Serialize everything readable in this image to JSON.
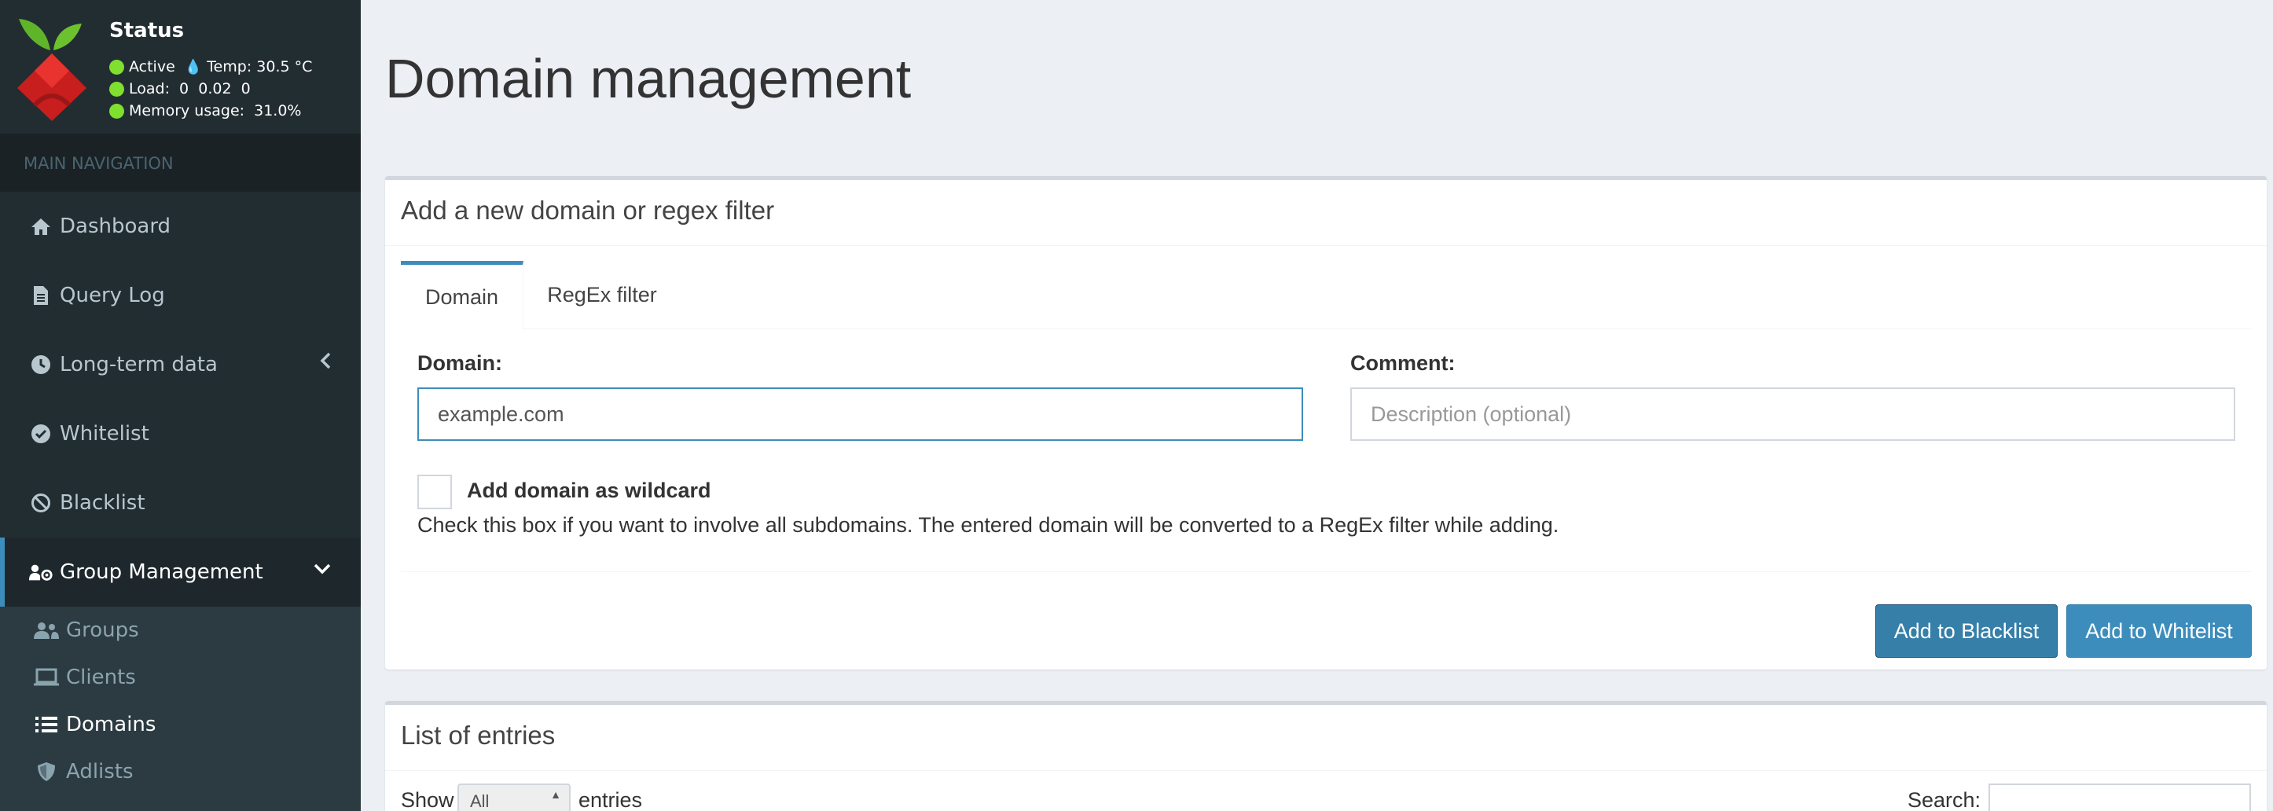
{
  "status": {
    "title": "Status",
    "active": "Active",
    "temp": "Temp: 30.5 °C",
    "load": "Load:  0  0.02  0",
    "memory": "Memory usage:  31.0%"
  },
  "nav": {
    "header": "MAIN NAVIGATION",
    "items": [
      {
        "label": "Dashboard",
        "icon": "home-icon"
      },
      {
        "label": "Query Log",
        "icon": "file-icon"
      },
      {
        "label": "Long-term data",
        "icon": "clock-icon"
      },
      {
        "label": "Whitelist",
        "icon": "check-circle-icon"
      },
      {
        "label": "Blacklist",
        "icon": "ban-icon"
      },
      {
        "label": "Group Management",
        "icon": "users-cog-icon"
      }
    ],
    "submenu": [
      {
        "label": "Groups",
        "icon": "user-friends-icon"
      },
      {
        "label": "Clients",
        "icon": "laptop-icon"
      },
      {
        "label": "Domains",
        "icon": "list-icon"
      },
      {
        "label": "Adlists",
        "icon": "shield-icon"
      }
    ]
  },
  "page": {
    "title": "Domain management"
  },
  "add_box": {
    "header": "Add a new domain or regex filter",
    "tabs": [
      "Domain",
      "RegEx filter"
    ],
    "domain_label": "Domain:",
    "domain_value": "example.com",
    "comment_label": "Comment:",
    "comment_placeholder": "Description (optional)",
    "wildcard_label": "Add domain as wildcard",
    "wildcard_help": "Check this box if you want to involve all subdomains. The entered domain will be converted to a RegEx filter while adding.",
    "blacklist_button": "Add to Blacklist",
    "whitelist_button": "Add to Whitelist"
  },
  "list_box": {
    "header": "List of entries",
    "show_label": "Show",
    "show_value": "All",
    "entries_label": "entries",
    "search_label": "Search:"
  },
  "colors": {
    "sidebar": "#222d32",
    "accent": "#3c8dbc",
    "status_dot": "#7fe02f"
  }
}
